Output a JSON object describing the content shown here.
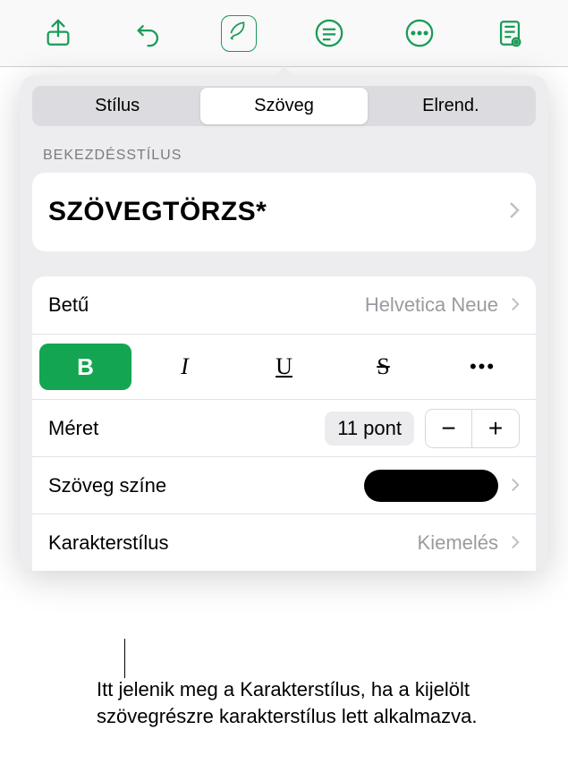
{
  "tabs": {
    "style": "Stílus",
    "text": "Szöveg",
    "arrange": "Elrend."
  },
  "section": {
    "paragraph_style": "BEKEZDÉSSTÍLUS"
  },
  "paragraph_style_name": "SZÖVEGTÖRZS*",
  "font": {
    "label": "Betű",
    "value": "Helvetica Neue"
  },
  "format_buttons": {
    "bold": "B",
    "italic": "I",
    "underline": "U",
    "strike": "S",
    "more": "•••"
  },
  "size": {
    "label": "Méret",
    "value": "11 pont",
    "minus": "−",
    "plus": "+"
  },
  "text_color": {
    "label": "Szöveg színe"
  },
  "char_style": {
    "label": "Karakterstílus",
    "value": "Kiemelés"
  },
  "callout": "Itt jelenik meg a Karakterstílus, ha a kijelölt szövegrészre karakterstílus lett alkalmazva."
}
